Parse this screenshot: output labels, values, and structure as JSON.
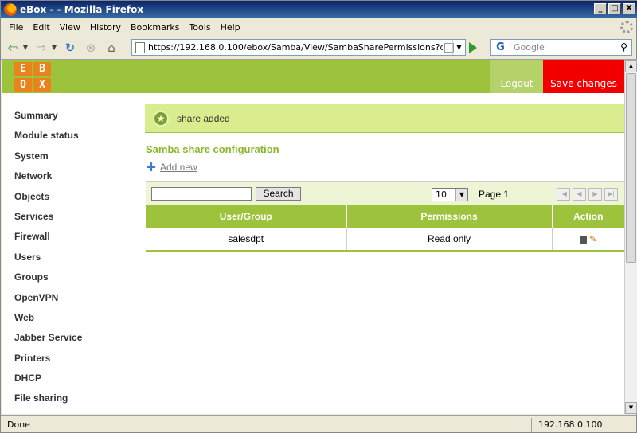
{
  "window": {
    "title": "eBox - - Mozilla Firefox",
    "min": "_",
    "max": "□",
    "close": "X"
  },
  "menu": [
    "File",
    "Edit",
    "View",
    "History",
    "Bookmarks",
    "Tools",
    "Help"
  ],
  "nav": {
    "url": "https://192.168.0.100/ebox/Samba/View/SambaSharePermissions?directory=Sa",
    "search_placeholder": "Google",
    "search_engine": "G"
  },
  "ebox": {
    "logo_letters": [
      "E",
      "B",
      "O",
      "X"
    ],
    "logout": "Logout",
    "save_changes": "Save changes"
  },
  "sidebar": {
    "items": [
      "Summary",
      "Module status",
      "System",
      "Network",
      "Objects",
      "Services",
      "Firewall",
      "Users",
      "Groups",
      "OpenVPN",
      "Web",
      "Jabber Service",
      "Printers",
      "DHCP",
      "File sharing"
    ]
  },
  "main": {
    "message": "share added",
    "section_title": "Samba share configuration",
    "add_new": "Add new",
    "search_button": "Search",
    "search_value": "",
    "page_size": "10",
    "page_label": "Page 1",
    "table": {
      "headers": [
        "User/Group",
        "Permissions",
        "Action"
      ],
      "rows": [
        {
          "user": "salesdpt",
          "permissions": "Read only"
        }
      ]
    }
  },
  "status": {
    "text": "Done",
    "host": "192.168.0.100"
  },
  "colors": {
    "accent_green": "#9dc23b",
    "save_red": "#f20000",
    "title_green": "#8ab62a"
  }
}
